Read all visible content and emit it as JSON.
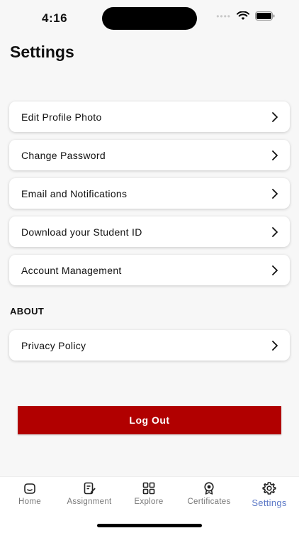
{
  "status": {
    "time": "4:16"
  },
  "page": {
    "title": "Settings"
  },
  "menu": {
    "items": [
      {
        "label": "Edit Profile Photo"
      },
      {
        "label": "Change Password"
      },
      {
        "label": "Email and Notifications"
      },
      {
        "label": "Download your Student ID"
      },
      {
        "label": "Account Management"
      }
    ]
  },
  "about": {
    "header": "ABOUT",
    "items": [
      {
        "label": "Privacy Policy"
      }
    ]
  },
  "logout": {
    "label": "Log Out"
  },
  "tabbar": {
    "active": "Settings",
    "tabs": [
      {
        "label": "Home",
        "icon": "home-icon"
      },
      {
        "label": "Assignment",
        "icon": "assignment-icon"
      },
      {
        "label": "Explore",
        "icon": "grid-icon"
      },
      {
        "label": "Certificates",
        "icon": "certificate-icon"
      },
      {
        "label": "Settings",
        "icon": "gear-icon"
      }
    ]
  },
  "colors": {
    "accent": "#5a77c6",
    "logout": "#b10000",
    "background": "#f7f7f7"
  }
}
